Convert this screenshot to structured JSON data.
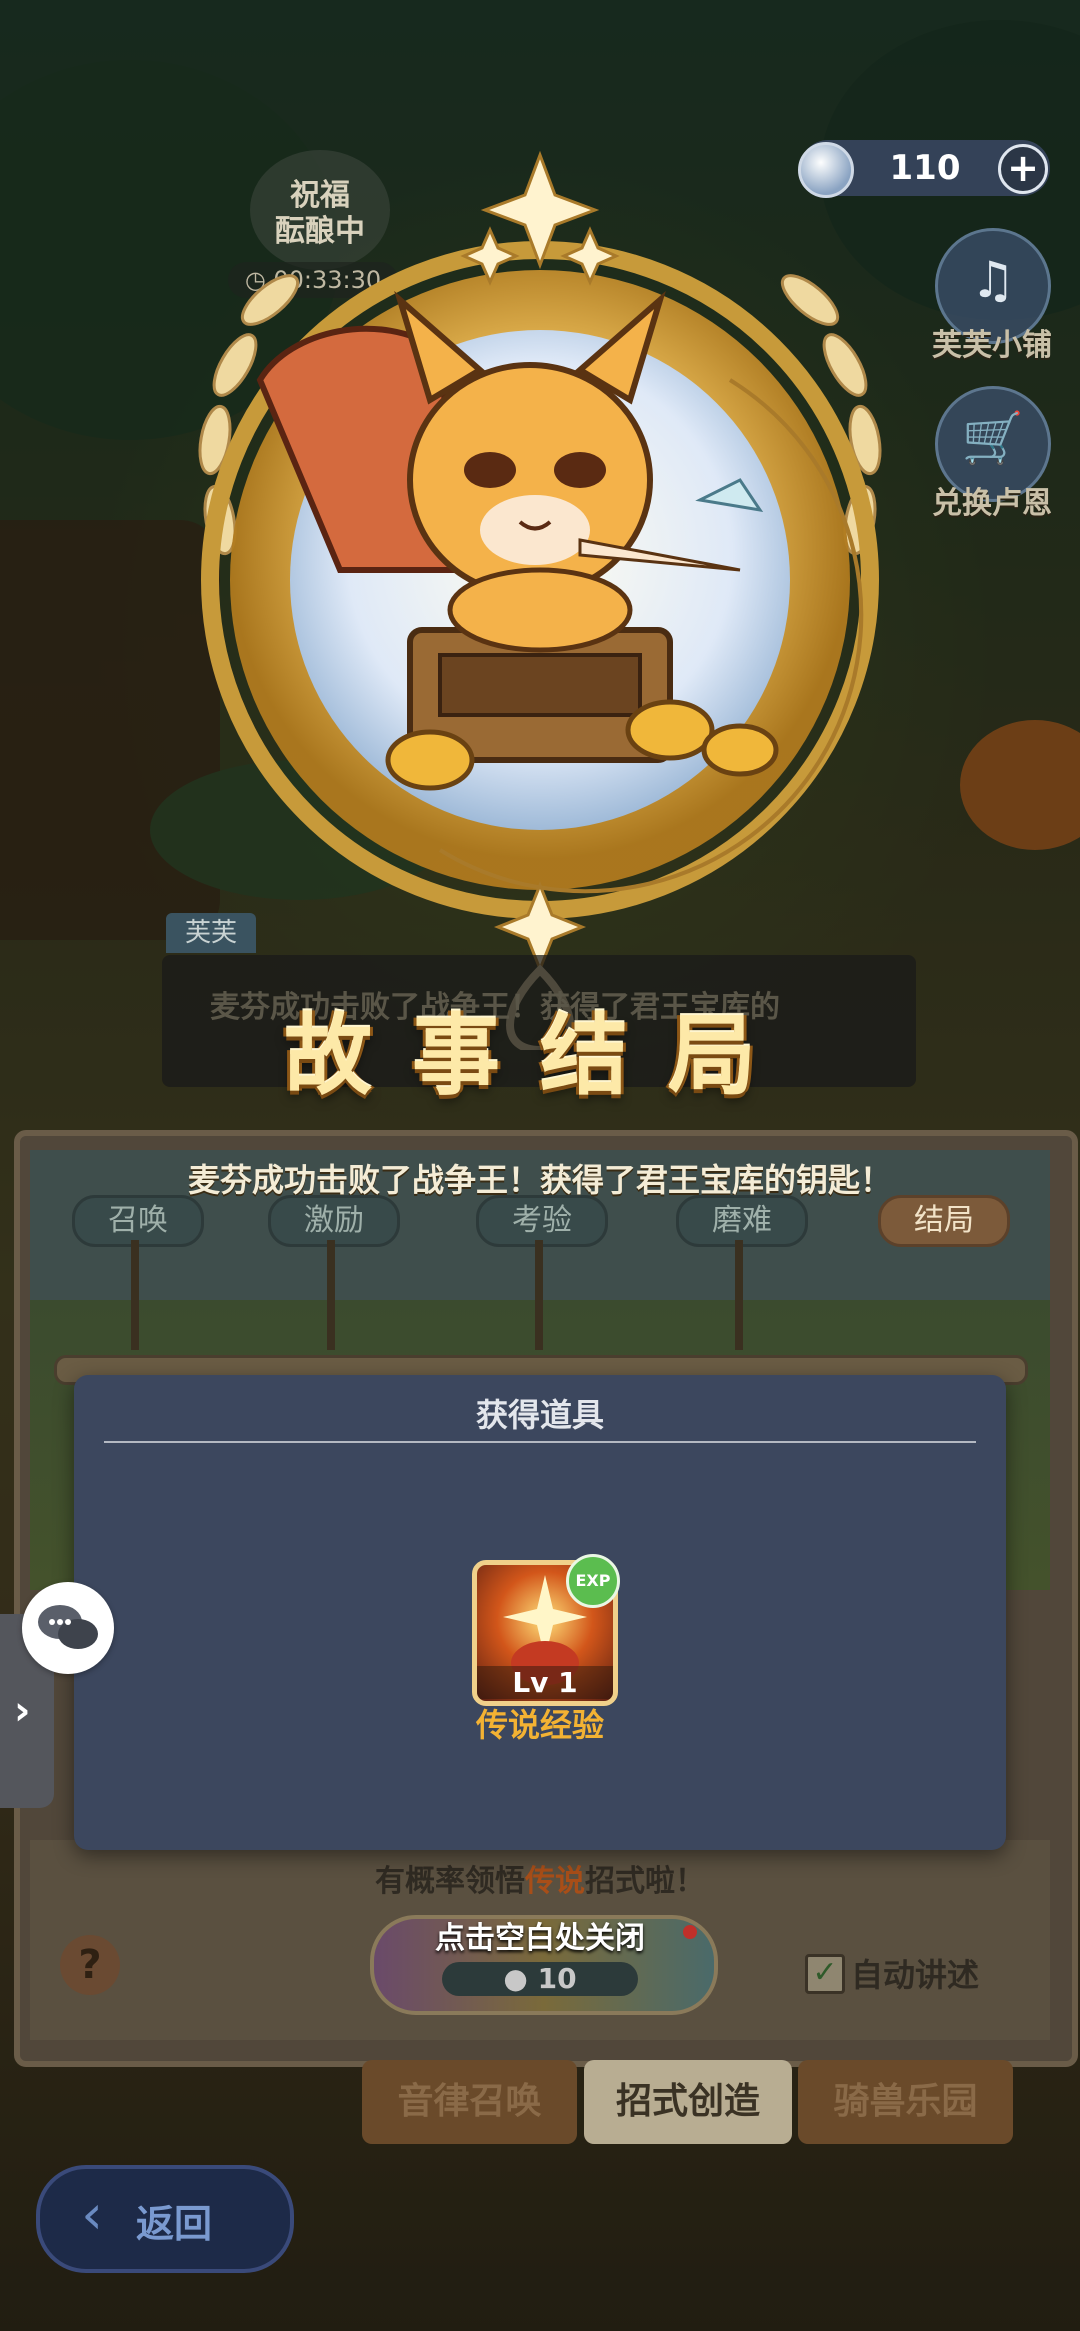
{
  "currency": {
    "amount": "110",
    "plus_icon": "plus-icon",
    "coin_icon": "star-coin-icon"
  },
  "blessing": {
    "line1": "祝福",
    "line2": "酝酿中",
    "timer": "00:33:30"
  },
  "side_buttons": [
    {
      "label": "芙芙小铺",
      "icon": "harp-icon"
    },
    {
      "label": "兑换卢恩",
      "icon": "cart-icon"
    }
  ],
  "story": {
    "speaker": "芙芙",
    "behind_text": "麦芬成功击败了战争王！获得了君王宝库的",
    "title": "故事结局",
    "description": "麦芬成功击败了战争王！获得了君王宝库的钥匙！",
    "stages": [
      "召唤",
      "激励",
      "考验",
      "磨难",
      "结局"
    ],
    "active_stage": "结局",
    "hint_prefix": "有概率领悟",
    "hint_highlight": "传说",
    "hint_suffix": "招式啦！",
    "create_cost": "10",
    "auto_narrate": "自动讲述",
    "auto_checked": true
  },
  "dialog": {
    "title": "获得道具",
    "item_level": "Lv 1",
    "item_badge": "EXP",
    "item_name": "传说经验",
    "close_hint": "点击空白处关闭"
  },
  "tabs": [
    "音律召唤",
    "招式创造",
    "骑兽乐园"
  ],
  "active_tab": "招式创造",
  "back_label": "返回",
  "colors": {
    "title_gold": "#fde9a8",
    "item_name": "#f3b233",
    "dialog_bg": "#3c475e",
    "exp_badge": "#5bbd4f"
  }
}
